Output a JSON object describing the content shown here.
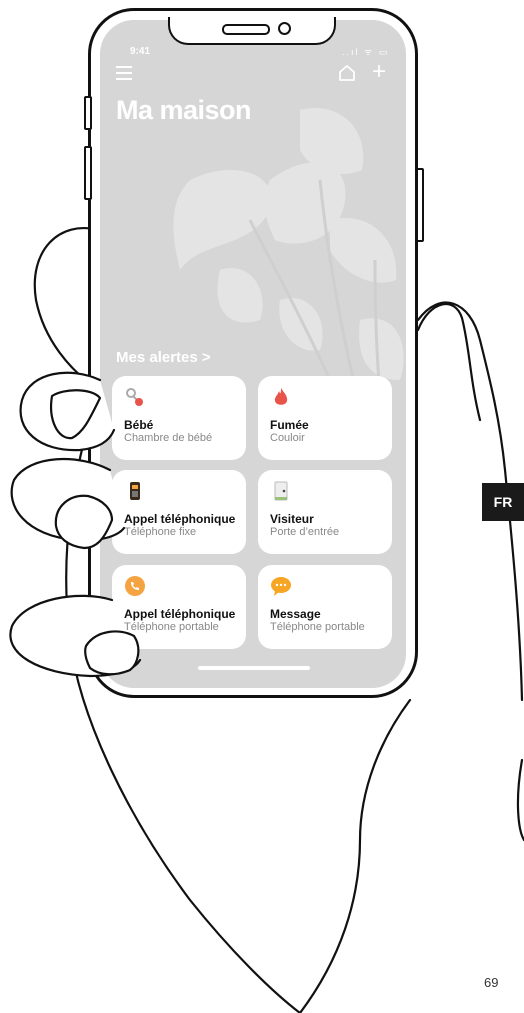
{
  "status": {
    "time": "9:41",
    "indicators": "..ıl ᯤ ▭"
  },
  "header": {
    "title": "Ma maison",
    "menu_icon": "menu-icon",
    "home_icon": "home-icon",
    "add_label": "+"
  },
  "alerts": {
    "link_label": "Mes alertes >",
    "cards": [
      {
        "title": "Bébé",
        "subtitle": "Chambre de bébé",
        "icon": "pacifier-icon"
      },
      {
        "title": "Fumée",
        "subtitle": "Couloir",
        "icon": "flame-icon"
      },
      {
        "title": "Appel téléphonique",
        "subtitle": "Téléphone fixe",
        "icon": "landline-phone-icon"
      },
      {
        "title": "Visiteur",
        "subtitle": "Porte d’entrée",
        "icon": "doorbell-icon"
      },
      {
        "title": "Appel téléphonique",
        "subtitle": "Téléphone portable",
        "icon": "mobile-call-icon"
      },
      {
        "title": "Message",
        "subtitle": "Téléphone portable",
        "icon": "message-bubble-icon"
      }
    ]
  },
  "page": {
    "language_badge": "FR",
    "page_number": "69"
  },
  "colors": {
    "screen_bg": "#d6d6d6",
    "flame": "#e8534a",
    "call_orange": "#f4a340",
    "message_orange": "#f6a623"
  }
}
